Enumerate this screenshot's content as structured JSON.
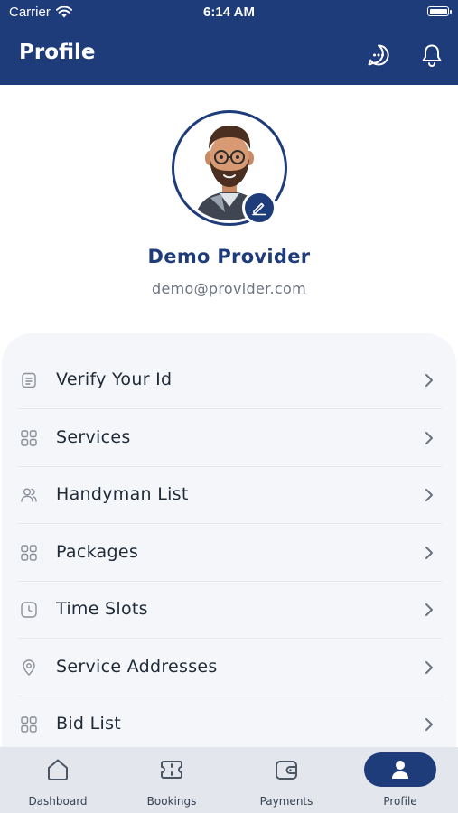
{
  "status_bar": {
    "carrier": "Carrier",
    "time": "6:14 AM"
  },
  "app_bar": {
    "title": "Profile",
    "icons": [
      "chat-icon",
      "bell-icon"
    ]
  },
  "profile": {
    "name": "Demo Provider",
    "email": "demo@provider.com"
  },
  "menu": {
    "items": [
      {
        "label": "Verify Your Id",
        "icon": "document-icon"
      },
      {
        "label": "Services",
        "icon": "grid-icon"
      },
      {
        "label": "Handyman List",
        "icon": "users-icon"
      },
      {
        "label": "Packages",
        "icon": "grid-icon"
      },
      {
        "label": "Time Slots",
        "icon": "clock-icon"
      },
      {
        "label": "Service Addresses",
        "icon": "location-pin-icon"
      },
      {
        "label": "Bid List",
        "icon": "grid-icon"
      }
    ]
  },
  "bottom_nav": {
    "items": [
      {
        "label": "Dashboard",
        "icon": "home-icon"
      },
      {
        "label": "Bookings",
        "icon": "ticket-icon"
      },
      {
        "label": "Payments",
        "icon": "wallet-icon"
      },
      {
        "label": "Profile",
        "icon": "person-icon",
        "active": true
      }
    ]
  },
  "colors": {
    "primary": "#1f3c7a",
    "menu_background": "#f4f6f9",
    "nav_background": "#e3e7ed"
  }
}
